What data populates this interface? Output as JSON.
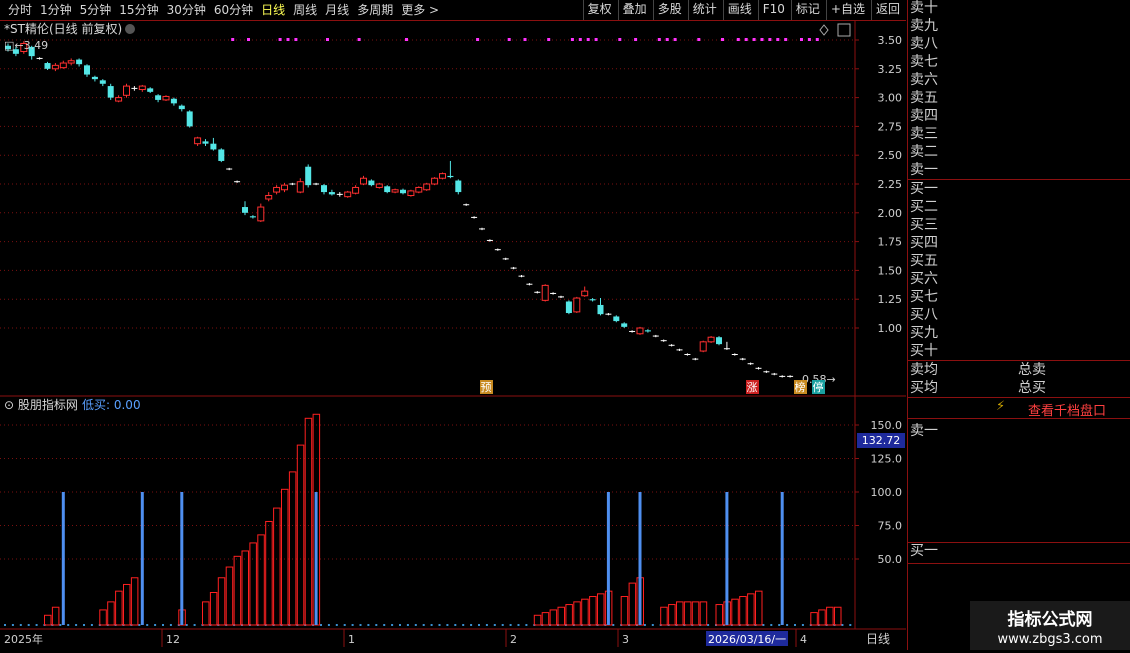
{
  "toolbar": {
    "periods": [
      "分时",
      "1分钟",
      "5分钟",
      "15分钟",
      "30分钟",
      "60分钟",
      "日线",
      "周线",
      "月线",
      "多周期",
      "更多 >"
    ],
    "active_period": "日线",
    "tools": [
      "复权",
      "叠加",
      "多股",
      "统计",
      "画线",
      "F10",
      "+自选",
      "返回"
    ],
    "mark_label": "标记"
  },
  "main_chart": {
    "title": "*ST精伦(日线 前复权)",
    "high_label": "3.49",
    "low_label": "0.58",
    "badges": [
      "预",
      "涨",
      "榜",
      "停"
    ],
    "y_ticks": [
      "3.50",
      "3.25",
      "3.00",
      "2.75",
      "2.50",
      "2.25",
      "2.00",
      "1.75",
      "1.50",
      "1.25",
      "1.00"
    ],
    "colors": {
      "up": "#ff3030",
      "down": "#54e6e6",
      "grid": "#7a1010",
      "flat": "#ffffff",
      "dot": "#ff33ff"
    }
  },
  "indicator": {
    "name": "股朋指标网",
    "sub_label": "低买: 0.00",
    "current_value": "132.72",
    "y_ticks": [
      "150.0",
      "125.0",
      "100.0",
      "75.0",
      "50.0"
    ]
  },
  "x_axis": {
    "labels": [
      "2025年",
      "12",
      "1",
      "2",
      "3",
      "2026/03/16/一",
      "4"
    ],
    "period": "日线"
  },
  "order_book": {
    "sell_levels": [
      "卖十",
      "卖九",
      "卖八",
      "卖七",
      "卖六",
      "卖五",
      "卖四",
      "卖三",
      "卖二",
      "卖一"
    ],
    "buy_levels": [
      "买一",
      "买二",
      "买三",
      "买四",
      "买五",
      "买六",
      "买七",
      "买八",
      "买九",
      "买十"
    ],
    "sell_avg": "卖均",
    "total_sell": "总卖",
    "buy_avg": "买均",
    "total_buy": "总买",
    "depth_button": "查看千档盘口",
    "sell_one": "卖一",
    "buy_one": "买一"
  },
  "watermark": {
    "title": "指标公式网",
    "url": "www.zbgs3.com"
  },
  "candles": [
    {
      "o": 3.45,
      "c": 3.42,
      "h": 3.47,
      "l": 3.4
    },
    {
      "o": 3.42,
      "c": 3.38,
      "h": 3.44,
      "l": 3.36
    },
    {
      "o": 3.4,
      "c": 3.47,
      "h": 3.49,
      "l": 3.38
    },
    {
      "o": 3.44,
      "c": 3.36,
      "h": 3.45,
      "l": 3.33
    },
    {
      "o": 3.34,
      "c": 3.34,
      "h": 3.35,
      "l": 3.33
    },
    {
      "o": 3.3,
      "c": 3.25,
      "h": 3.31,
      "l": 3.24
    },
    {
      "o": 3.25,
      "c": 3.28,
      "h": 3.3,
      "l": 3.23
    },
    {
      "o": 3.26,
      "c": 3.3,
      "h": 3.32,
      "l": 3.25
    },
    {
      "o": 3.3,
      "c": 3.32,
      "h": 3.34,
      "l": 3.28
    },
    {
      "o": 3.33,
      "c": 3.29,
      "h": 3.34,
      "l": 3.27
    },
    {
      "o": 3.28,
      "c": 3.2,
      "h": 3.29,
      "l": 3.18
    },
    {
      "o": 3.18,
      "c": 3.16,
      "h": 3.19,
      "l": 3.14
    },
    {
      "o": 3.15,
      "c": 3.12,
      "h": 3.16,
      "l": 3.1
    },
    {
      "o": 3.1,
      "c": 3.0,
      "h": 3.12,
      "l": 2.98
    },
    {
      "o": 2.97,
      "c": 3.0,
      "h": 3.02,
      "l": 2.96
    },
    {
      "o": 3.02,
      "c": 3.1,
      "h": 3.12,
      "l": 3.0
    },
    {
      "o": 3.08,
      "c": 3.08,
      "h": 3.1,
      "l": 3.06
    },
    {
      "o": 3.07,
      "c": 3.1,
      "h": 3.11,
      "l": 3.05
    },
    {
      "o": 3.08,
      "c": 3.05,
      "h": 3.09,
      "l": 3.04
    },
    {
      "o": 3.02,
      "c": 2.98,
      "h": 3.03,
      "l": 2.96
    },
    {
      "o": 2.98,
      "c": 3.01,
      "h": 3.02,
      "l": 2.97
    },
    {
      "o": 2.99,
      "c": 2.95,
      "h": 3.0,
      "l": 2.93
    },
    {
      "o": 2.93,
      "c": 2.9,
      "h": 2.94,
      "l": 2.88
    },
    {
      "o": 2.88,
      "c": 2.75,
      "h": 2.89,
      "l": 2.74
    },
    {
      "o": 2.6,
      "c": 2.65,
      "h": 2.66,
      "l": 2.58
    },
    {
      "o": 2.62,
      "c": 2.6,
      "h": 2.64,
      "l": 2.58
    },
    {
      "o": 2.6,
      "c": 2.55,
      "h": 2.65,
      "l": 2.54
    },
    {
      "o": 2.55,
      "c": 2.45,
      "h": 2.56,
      "l": 2.44
    },
    {
      "o": 2.38,
      "c": 2.38,
      "h": 2.39,
      "l": 2.37
    },
    {
      "o": 2.27,
      "c": 2.27,
      "h": 2.28,
      "l": 2.26
    },
    {
      "o": 2.05,
      "c": 2.0,
      "h": 2.1,
      "l": 1.98
    },
    {
      "o": 1.97,
      "c": 1.96,
      "h": 1.98,
      "l": 1.95
    },
    {
      "o": 1.93,
      "c": 2.05,
      "h": 2.08,
      "l": 1.92
    },
    {
      "o": 2.12,
      "c": 2.15,
      "h": 2.18,
      "l": 2.1
    },
    {
      "o": 2.18,
      "c": 2.22,
      "h": 2.24,
      "l": 2.16
    },
    {
      "o": 2.2,
      "c": 2.24,
      "h": 2.26,
      "l": 2.18
    },
    {
      "o": 2.25,
      "c": 2.25,
      "h": 2.26,
      "l": 2.24
    },
    {
      "o": 2.18,
      "c": 2.27,
      "h": 2.3,
      "l": 2.17
    },
    {
      "o": 2.4,
      "c": 2.24,
      "h": 2.42,
      "l": 2.22
    },
    {
      "o": 2.25,
      "c": 2.25,
      "h": 2.26,
      "l": 2.24
    },
    {
      "o": 2.24,
      "c": 2.18,
      "h": 2.25,
      "l": 2.16
    },
    {
      "o": 2.18,
      "c": 2.16,
      "h": 2.2,
      "l": 2.15
    },
    {
      "o": 2.16,
      "c": 2.16,
      "h": 2.18,
      "l": 2.14
    },
    {
      "o": 2.14,
      "c": 2.18,
      "h": 2.19,
      "l": 2.13
    },
    {
      "o": 2.17,
      "c": 2.22,
      "h": 2.24,
      "l": 2.16
    },
    {
      "o": 2.25,
      "c": 2.3,
      "h": 2.32,
      "l": 2.24
    },
    {
      "o": 2.28,
      "c": 2.24,
      "h": 2.29,
      "l": 2.23
    },
    {
      "o": 2.22,
      "c": 2.25,
      "h": 2.26,
      "l": 2.21
    },
    {
      "o": 2.23,
      "c": 2.18,
      "h": 2.24,
      "l": 2.17
    },
    {
      "o": 2.18,
      "c": 2.2,
      "h": 2.21,
      "l": 2.17
    },
    {
      "o": 2.2,
      "c": 2.17,
      "h": 2.21,
      "l": 2.16
    },
    {
      "o": 2.15,
      "c": 2.19,
      "h": 2.2,
      "l": 2.14
    },
    {
      "o": 2.18,
      "c": 2.22,
      "h": 2.23,
      "l": 2.17
    },
    {
      "o": 2.2,
      "c": 2.25,
      "h": 2.26,
      "l": 2.19
    },
    {
      "o": 2.25,
      "c": 2.3,
      "h": 2.31,
      "l": 2.24
    },
    {
      "o": 2.3,
      "c": 2.34,
      "h": 2.35,
      "l": 2.29
    },
    {
      "o": 2.32,
      "c": 2.31,
      "h": 2.45,
      "l": 2.3
    },
    {
      "o": 2.28,
      "c": 2.18,
      "h": 2.29,
      "l": 2.16
    },
    {
      "o": 2.07,
      "c": 2.07,
      "h": 2.08,
      "l": 2.06
    },
    {
      "o": 1.96,
      "c": 1.96,
      "h": 1.97,
      "l": 1.95
    },
    {
      "o": 1.86,
      "c": 1.86,
      "h": 1.87,
      "l": 1.85
    },
    {
      "o": 1.76,
      "c": 1.76,
      "h": 1.77,
      "l": 1.75
    },
    {
      "o": 1.68,
      "c": 1.68,
      "h": 1.69,
      "l": 1.67
    },
    {
      "o": 1.6,
      "c": 1.6,
      "h": 1.61,
      "l": 1.59
    },
    {
      "o": 1.52,
      "c": 1.52,
      "h": 1.53,
      "l": 1.51
    },
    {
      "o": 1.45,
      "c": 1.45,
      "h": 1.46,
      "l": 1.44
    },
    {
      "o": 1.38,
      "c": 1.38,
      "h": 1.39,
      "l": 1.37
    },
    {
      "o": 1.31,
      "c": 1.31,
      "h": 1.32,
      "l": 1.3
    },
    {
      "o": 1.24,
      "c": 1.37,
      "h": 1.38,
      "l": 1.23
    },
    {
      "o": 1.3,
      "c": 1.3,
      "h": 1.31,
      "l": 1.29
    },
    {
      "o": 1.27,
      "c": 1.27,
      "h": 1.28,
      "l": 1.26
    },
    {
      "o": 1.23,
      "c": 1.13,
      "h": 1.24,
      "l": 1.12
    },
    {
      "o": 1.14,
      "c": 1.26,
      "h": 1.27,
      "l": 1.13
    },
    {
      "o": 1.28,
      "c": 1.32,
      "h": 1.36,
      "l": 1.27
    },
    {
      "o": 1.25,
      "c": 1.24,
      "h": 1.26,
      "l": 1.23
    },
    {
      "o": 1.2,
      "c": 1.12,
      "h": 1.26,
      "l": 1.11
    },
    {
      "o": 1.12,
      "c": 1.12,
      "h": 1.13,
      "l": 1.11
    },
    {
      "o": 1.1,
      "c": 1.06,
      "h": 1.11,
      "l": 1.05
    },
    {
      "o": 1.04,
      "c": 1.01,
      "h": 1.05,
      "l": 1.0
    },
    {
      "o": 0.97,
      "c": 0.97,
      "h": 0.98,
      "l": 0.96
    },
    {
      "o": 0.95,
      "c": 1.0,
      "h": 1.01,
      "l": 0.94
    },
    {
      "o": 0.98,
      "c": 0.97,
      "h": 0.99,
      "l": 0.96
    },
    {
      "o": 0.93,
      "c": 0.93,
      "h": 0.94,
      "l": 0.92
    },
    {
      "o": 0.89,
      "c": 0.89,
      "h": 0.9,
      "l": 0.88
    },
    {
      "o": 0.85,
      "c": 0.85,
      "h": 0.86,
      "l": 0.84
    },
    {
      "o": 0.81,
      "c": 0.81,
      "h": 0.82,
      "l": 0.8
    },
    {
      "o": 0.77,
      "c": 0.77,
      "h": 0.78,
      "l": 0.76
    },
    {
      "o": 0.73,
      "c": 0.73,
      "h": 0.74,
      "l": 0.72
    },
    {
      "o": 0.8,
      "c": 0.88,
      "h": 0.89,
      "l": 0.79
    },
    {
      "o": 0.88,
      "c": 0.92,
      "h": 0.93,
      "l": 0.87
    },
    {
      "o": 0.92,
      "c": 0.86,
      "h": 0.93,
      "l": 0.85
    },
    {
      "o": 0.82,
      "c": 0.82,
      "h": 0.88,
      "l": 0.81
    },
    {
      "o": 0.77,
      "c": 0.77,
      "h": 0.78,
      "l": 0.76
    },
    {
      "o": 0.73,
      "c": 0.73,
      "h": 0.74,
      "l": 0.72
    },
    {
      "o": 0.69,
      "c": 0.69,
      "h": 0.7,
      "l": 0.68
    },
    {
      "o": 0.65,
      "c": 0.65,
      "h": 0.66,
      "l": 0.64
    },
    {
      "o": 0.62,
      "c": 0.62,
      "h": 0.63,
      "l": 0.61
    },
    {
      "o": 0.6,
      "c": 0.6,
      "h": 0.61,
      "l": 0.59
    },
    {
      "o": 0.58,
      "c": 0.58,
      "h": 0.59,
      "l": 0.57
    },
    {
      "o": 0.58,
      "c": 0.58,
      "h": 0.59,
      "l": 0.57
    }
  ],
  "red_bars": [
    0,
    0,
    0,
    0,
    0,
    8,
    14,
    0,
    0,
    0,
    0,
    0,
    12,
    18,
    26,
    31,
    36,
    0,
    0,
    0,
    0,
    0,
    12,
    0,
    0,
    18,
    25,
    36,
    44,
    52,
    56,
    62,
    68,
    78,
    88,
    102,
    115,
    135,
    155,
    158,
    0,
    0,
    0,
    0,
    0,
    0,
    0,
    0,
    0,
    0,
    0,
    0,
    0,
    0,
    0,
    0,
    0,
    0,
    0,
    0,
    0,
    0,
    0,
    0,
    0,
    0,
    0,
    8,
    10,
    12,
    14,
    16,
    18,
    20,
    22,
    24,
    26,
    0,
    22,
    32,
    36,
    0,
    0,
    14,
    16,
    18,
    18,
    18,
    18,
    0,
    16,
    18,
    20,
    22,
    24,
    26,
    0,
    0,
    0,
    0,
    0,
    0,
    10,
    12,
    14,
    14
  ],
  "blue_spikes": [
    7,
    17,
    22,
    39,
    76,
    80,
    91,
    98
  ]
}
